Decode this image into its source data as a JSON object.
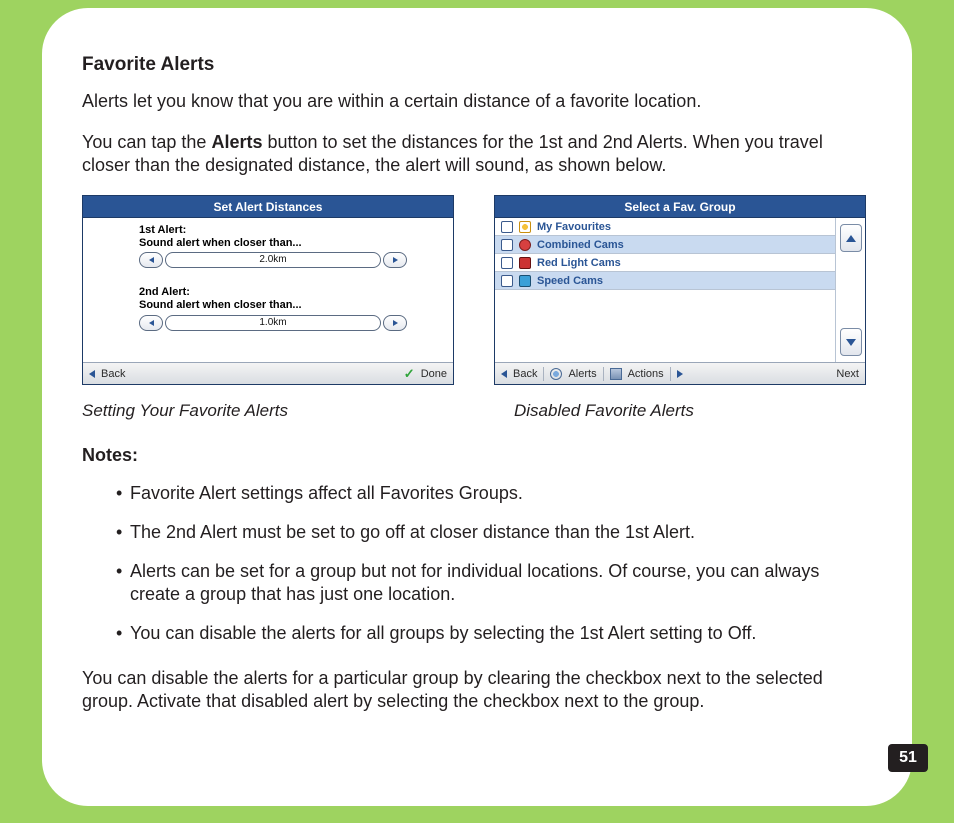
{
  "page": {
    "title": "Favorite Alerts",
    "intro": "Alerts let you know that you are within a certain distance of a favorite location.",
    "para2_pre": "You can tap the ",
    "para2_bold": "Alerts",
    "para2_post": " button to set the distances for the 1st and 2nd Alerts. When you travel closer than the designated distance, the alert will sound, as shown below.",
    "page_number": "51"
  },
  "screenshot1": {
    "title": "Set Alert Distances",
    "alert1_label_line1": "1st Alert:",
    "alert1_label_line2": "Sound alert when closer than...",
    "alert1_value": "2.0km",
    "alert2_label_line1": "2nd Alert:",
    "alert2_label_line2": "Sound alert when closer than...",
    "alert2_value": "1.0km",
    "footer_back": "Back",
    "footer_done": "Done",
    "caption": "Setting Your Favorite Alerts"
  },
  "screenshot2": {
    "title": "Select a Fav. Group",
    "items": [
      {
        "name": "My Favourites"
      },
      {
        "name": "Combined Cams"
      },
      {
        "name": "Red Light Cams"
      },
      {
        "name": "Speed Cams"
      }
    ],
    "footer_back": "Back",
    "footer_alerts": "Alerts",
    "footer_actions": "Actions",
    "footer_next": "Next",
    "caption": "Disabled Favorite Alerts"
  },
  "notes": {
    "heading": "Notes:",
    "items": [
      "Favorite Alert settings affect all Favorites Groups.",
      "The 2nd Alert must be set to go off at closer distance than the 1st Alert.",
      "Alerts can be set for a group but not for individual locations. Of course, you can always create a group that has just one location.",
      "You can disable the alerts for all groups by selecting the 1st Alert setting to Off."
    ]
  },
  "closing": "You can disable the alerts for a particular group by clearing the checkbox next to the selected group. Activate that disabled alert by selecting the checkbox next to the group."
}
